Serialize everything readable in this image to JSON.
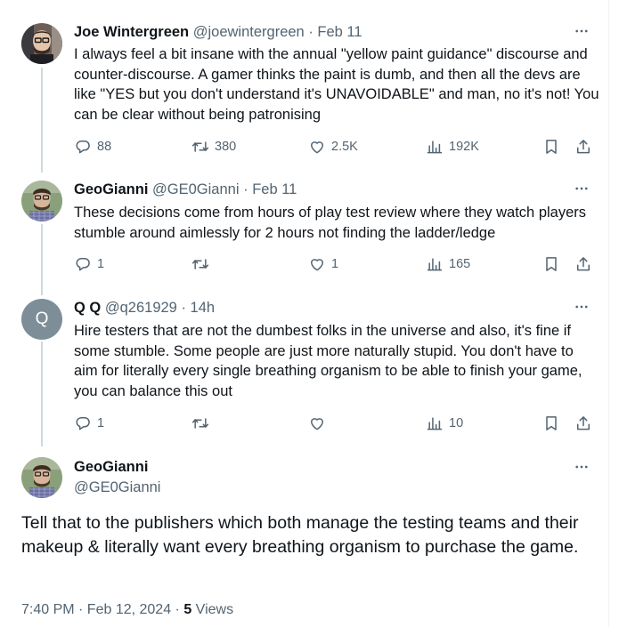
{
  "tweets": [
    {
      "name": "Joe Wintergreen",
      "handle": "@joewintergreen",
      "sep": "·",
      "time": "Feb 11",
      "text": "I always feel a bit insane with the annual \"yellow paint guidance\" discourse and counter-discourse. A gamer thinks the paint is dumb, and then all the devs are like \"YES but you don't understand it's UNAVOIDABLE\" and man, no it's not! You can be clear without being patronising",
      "replies": "88",
      "retweets": "380",
      "likes": "2.5K",
      "views": "192K"
    },
    {
      "name": "GeoGianni",
      "handle": "@GE0Gianni",
      "sep": "·",
      "time": "Feb 11",
      "text": "These decisions come from hours of play test review where they watch players stumble around aimlessly for 2 hours not finding the ladder/ledge",
      "replies": "1",
      "retweets": "",
      "likes": "1",
      "views": "165"
    },
    {
      "name": "Q Q",
      "handle": "@q261929",
      "sep": "·",
      "time": "14h",
      "avatar_letter": "Q",
      "text": "Hire testers that are not the dumbest folks in the universe and also, it's fine if some stumble. Some people are just more naturally stupid. You don't have to aim for literally every single breathing organism to be able to finish your game, you can balance this out",
      "replies": "1",
      "retweets": "",
      "likes": "",
      "views": "10"
    }
  ],
  "main_tweet": {
    "name": "GeoGianni",
    "handle": "@GE0Gianni",
    "text": "Tell that to the publishers which both manage the testing teams and their makeup & literally want every breathing organism to purchase the game.",
    "time": "7:40 PM · Feb 12, 2024 · ",
    "views_count": "5",
    "views_label": " Views"
  },
  "colors": {
    "text": "#0f1419",
    "muted": "#536471",
    "thread_line": "#cfd9de",
    "q_avatar": "#7d8e98"
  },
  "icons": [
    "more-icon",
    "reply-icon",
    "retweet-icon",
    "like-icon",
    "views-icon",
    "bookmark-icon",
    "share-icon"
  ]
}
